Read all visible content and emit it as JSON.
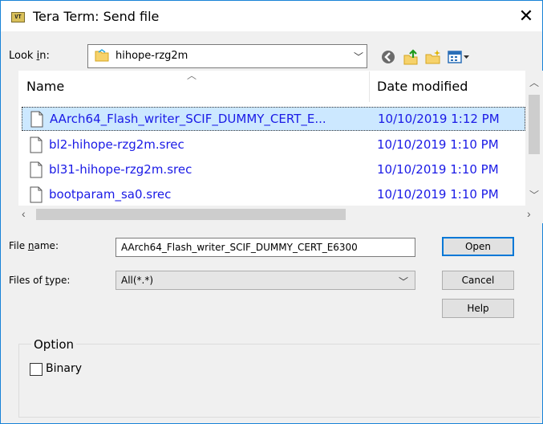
{
  "window": {
    "title": "Tera Term: Send file",
    "icon_text": "VT",
    "close_glyph": "✕"
  },
  "lookin": {
    "label": "Look in:",
    "value": "hihope-rzg2m"
  },
  "list": {
    "columns": [
      "Name",
      "Date modified"
    ],
    "rows": [
      {
        "name": "AArch64_Flash_writer_SCIF_DUMMY_CERT_E...",
        "date": "10/10/2019 1:12 PM",
        "selected": true
      },
      {
        "name": "bl2-hihope-rzg2m.srec",
        "date": "10/10/2019 1:10 PM",
        "selected": false
      },
      {
        "name": "bl31-hihope-rzg2m.srec",
        "date": "10/10/2019 1:10 PM",
        "selected": false
      },
      {
        "name": "bootparam_sa0.srec",
        "date": "10/10/2019 1:10 PM",
        "selected": false
      }
    ]
  },
  "form": {
    "filename_label": "File name:",
    "filename_value": "AArch64_Flash_writer_SCIF_DUMMY_CERT_E6300",
    "filetype_label": "Files of type:",
    "filetype_value": "All(*.*)"
  },
  "buttons": {
    "open": "Open",
    "cancel": "Cancel",
    "help": "Help"
  },
  "option": {
    "title": "Option",
    "binary_label": "Binary",
    "binary_checked": false
  },
  "colors": {
    "accent": "#0078d7",
    "link_text": "#1a1ae6",
    "selection": "#cce8ff"
  }
}
